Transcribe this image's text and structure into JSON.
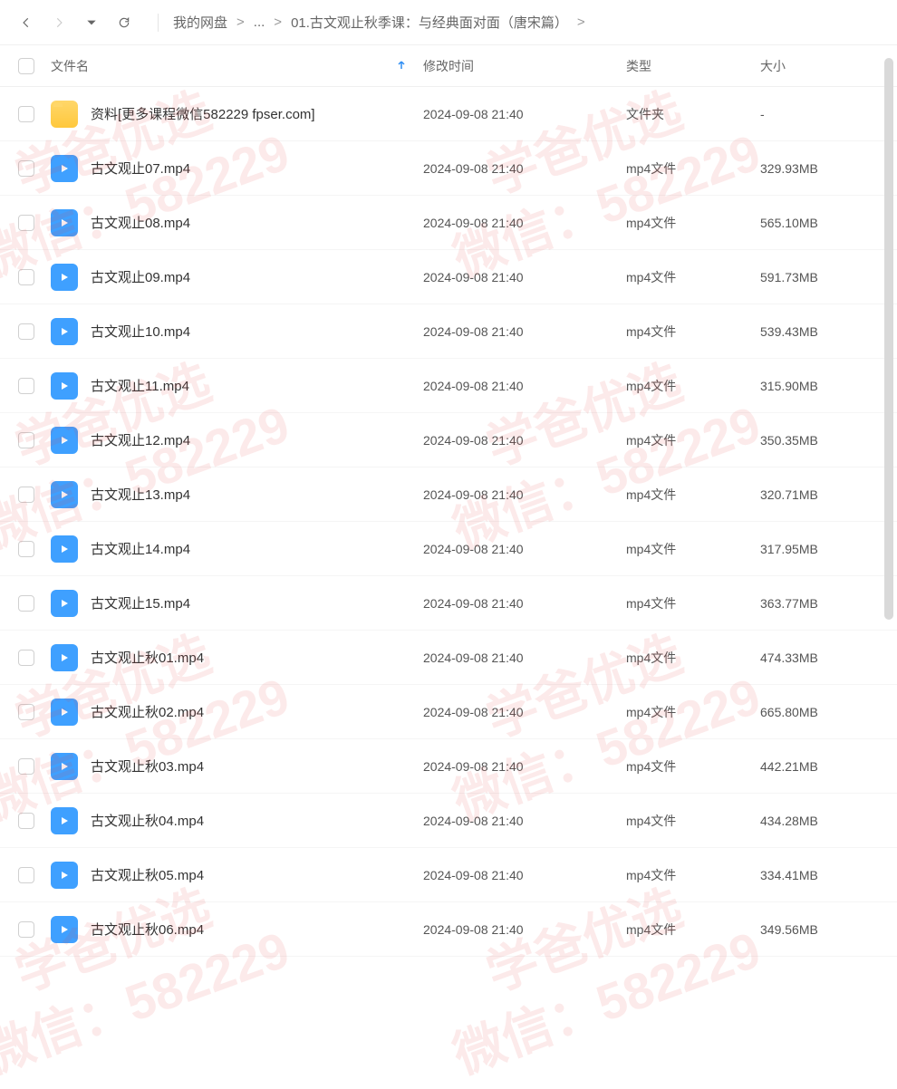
{
  "breadcrumbs": {
    "root": "我的网盘",
    "ellipsis": "...",
    "current": "01.古文观止秋季课：与经典面对面（唐宋篇）",
    "sep": ">"
  },
  "columns": {
    "name": "文件名",
    "time": "修改时间",
    "type": "类型",
    "size": "大小"
  },
  "watermark": {
    "line1": "学爸优选",
    "line2": "微信：582229"
  },
  "files": [
    {
      "icon": "folder",
      "name": "资料[更多课程微信582229 fpser.com]",
      "time": "2024-09-08 21:40",
      "type": "文件夹",
      "size": "-"
    },
    {
      "icon": "video",
      "name": "古文观止07.mp4",
      "time": "2024-09-08 21:40",
      "type": "mp4文件",
      "size": "329.93MB"
    },
    {
      "icon": "video",
      "name": "古文观止08.mp4",
      "time": "2024-09-08 21:40",
      "type": "mp4文件",
      "size": "565.10MB"
    },
    {
      "icon": "video",
      "name": "古文观止09.mp4",
      "time": "2024-09-08 21:40",
      "type": "mp4文件",
      "size": "591.73MB"
    },
    {
      "icon": "video",
      "name": "古文观止10.mp4",
      "time": "2024-09-08 21:40",
      "type": "mp4文件",
      "size": "539.43MB"
    },
    {
      "icon": "video",
      "name": "古文观止11.mp4",
      "time": "2024-09-08 21:40",
      "type": "mp4文件",
      "size": "315.90MB"
    },
    {
      "icon": "video",
      "name": "古文观止12.mp4",
      "time": "2024-09-08 21:40",
      "type": "mp4文件",
      "size": "350.35MB"
    },
    {
      "icon": "video",
      "name": "古文观止13.mp4",
      "time": "2024-09-08 21:40",
      "type": "mp4文件",
      "size": "320.71MB"
    },
    {
      "icon": "video",
      "name": "古文观止14.mp4",
      "time": "2024-09-08 21:40",
      "type": "mp4文件",
      "size": "317.95MB"
    },
    {
      "icon": "video",
      "name": "古文观止15.mp4",
      "time": "2024-09-08 21:40",
      "type": "mp4文件",
      "size": "363.77MB"
    },
    {
      "icon": "video",
      "name": "古文观止秋01.mp4",
      "time": "2024-09-08 21:40",
      "type": "mp4文件",
      "size": "474.33MB"
    },
    {
      "icon": "video",
      "name": "古文观止秋02.mp4",
      "time": "2024-09-08 21:40",
      "type": "mp4文件",
      "size": "665.80MB"
    },
    {
      "icon": "video",
      "name": "古文观止秋03.mp4",
      "time": "2024-09-08 21:40",
      "type": "mp4文件",
      "size": "442.21MB"
    },
    {
      "icon": "video",
      "name": "古文观止秋04.mp4",
      "time": "2024-09-08 21:40",
      "type": "mp4文件",
      "size": "434.28MB"
    },
    {
      "icon": "video",
      "name": "古文观止秋05.mp4",
      "time": "2024-09-08 21:40",
      "type": "mp4文件",
      "size": "334.41MB"
    },
    {
      "icon": "video",
      "name": "古文观止秋06.mp4",
      "time": "2024-09-08 21:40",
      "type": "mp4文件",
      "size": "349.56MB"
    }
  ]
}
